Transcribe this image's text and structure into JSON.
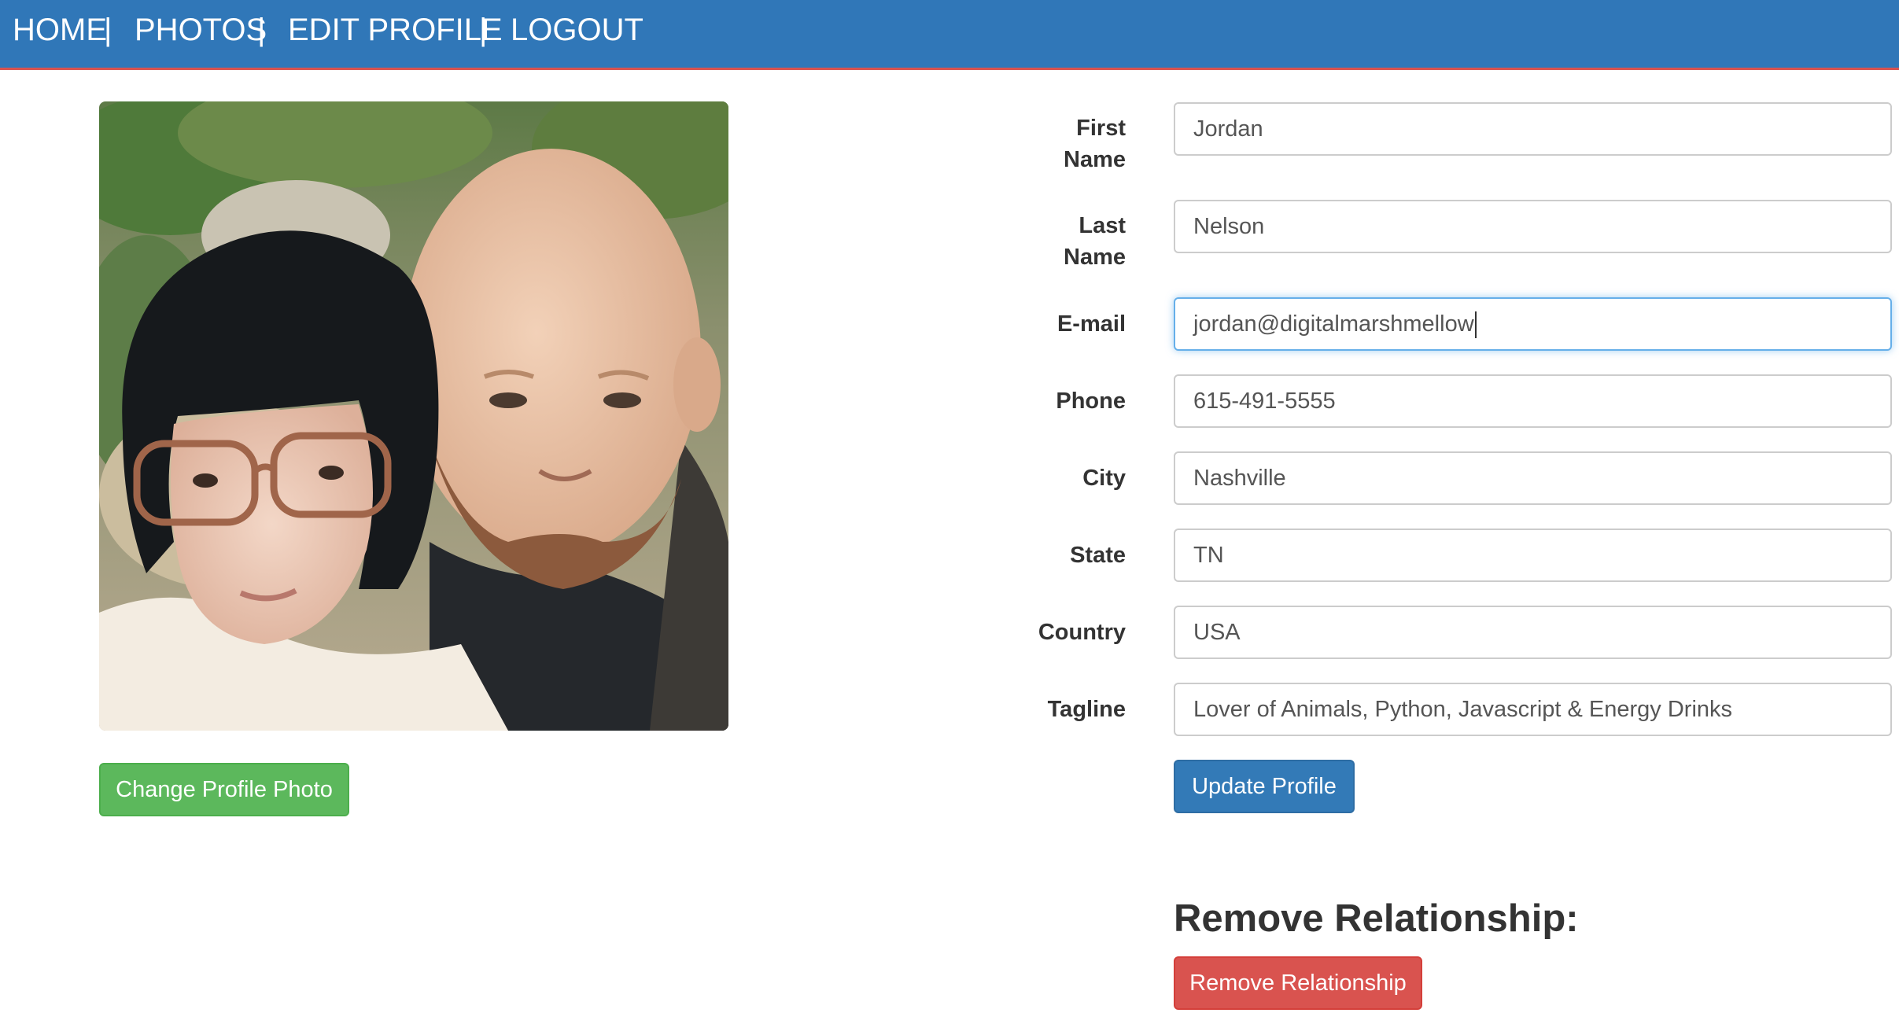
{
  "nav": {
    "items": [
      "HOME",
      "PHOTOS",
      "EDIT PROFILE",
      "LOGOUT"
    ],
    "separator": "|",
    "background": "#3077b8",
    "accent_border": "#d9534f"
  },
  "profile_photo": {
    "alt": "Profile photo"
  },
  "buttons": {
    "change_photo": "Change Profile Photo",
    "update_profile": "Update Profile",
    "remove_relationship": "Remove Relationship"
  },
  "form": {
    "first_name": {
      "label_line1": "First",
      "label_line2": "Name",
      "value": "Jordan"
    },
    "last_name": {
      "label_line1": "Last",
      "label_line2": "Name",
      "value": "Nelson"
    },
    "email": {
      "label": "E-mail",
      "value": "jordan@digitalmarshmellow"
    },
    "phone": {
      "label": "Phone",
      "value": "615-491-5555"
    },
    "city": {
      "label": "City",
      "value": "Nashville"
    },
    "state": {
      "label": "State",
      "value": "TN"
    },
    "country": {
      "label": "Country",
      "value": "USA"
    },
    "tagline": {
      "label": "Tagline",
      "value": "Lover of Animals, Python, Javascript & Energy Drinks"
    }
  },
  "remove_section": {
    "heading": "Remove Relationship:"
  },
  "colors": {
    "success": "#5cb85c",
    "primary": "#337ab7",
    "danger": "#d9534f",
    "focus": "#66afe9"
  }
}
